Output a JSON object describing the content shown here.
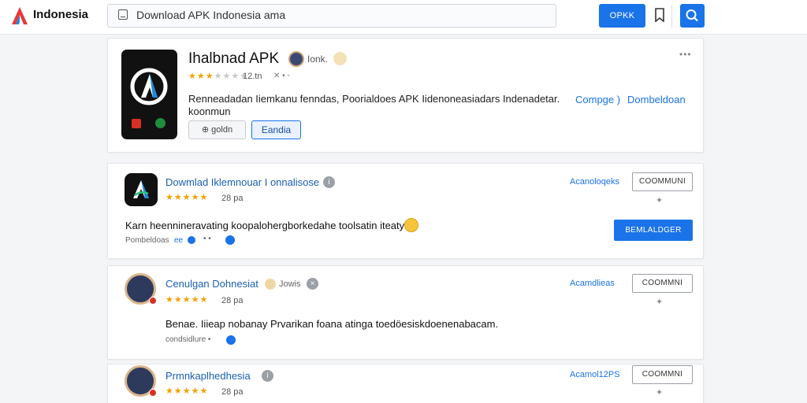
{
  "header": {
    "brand": "Indonesia",
    "search_placeholder": "Download APK Indonesia  ama",
    "top_button": "OPKK"
  },
  "hero": {
    "title": "Ihalbnad APK",
    "user": "Ionk.",
    "rating_count": "12.tn",
    "meta": "✕ • ◦",
    "description": "Renneadadan Iiemkanu fenndas, Poorialdoes APK Iidenoneasiadars Indenadetar. koonmun",
    "link_1": "Compge )",
    "link_2": "Dombeldoan",
    "ghost_button": "⊕ goldn",
    "outline_button": "Eandia",
    "more": "•••",
    "stars_filled": 3,
    "stars_total": 7
  },
  "apps": [
    {
      "title": "Dowmlad Iklemnouar I onnalisose",
      "stars": "★★★★★",
      "count": "28 pa",
      "description": "Karn heennineravating  koopalohergborkedahe toolsatin iteaty:",
      "meta": "Pombeldoas",
      "meta_tag": "ee",
      "meta_dots": "• •",
      "link": "Acanoloqeks",
      "comment_button": "COOMMUNI",
      "primary_button": "BEMLALDGER"
    },
    {
      "title": "Cenulgan Dohnesiat",
      "sub": "Jowis",
      "stars": "★★★★★",
      "count": "28 pa",
      "description": "Benae. Iiieap nobanay Prvarikan foana atinga toedöesiskdoenenabacam.",
      "meta": "condsidlure •",
      "link": "Acamdlieas",
      "comment_button": "COOMMNI"
    },
    {
      "title": "Prmnkaplhedhesia",
      "stars": "★★★★★",
      "count": "28 pa",
      "link": "Acamol12PS",
      "comment_button": "COOMMNI"
    }
  ],
  "colors": {
    "accent": "#1a73e8",
    "star": "#f4a000",
    "link": "#1a5fb4"
  }
}
